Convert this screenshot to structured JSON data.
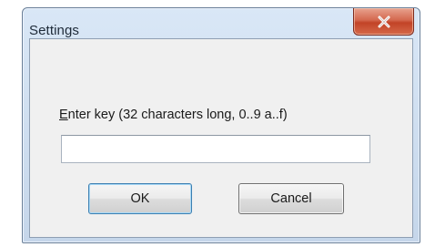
{
  "window": {
    "title": "Settings",
    "close_icon": "close-x-icon"
  },
  "form": {
    "prompt_mnemonic": "E",
    "prompt_rest": "nter key (32 characters long, 0..9 a..f)",
    "key_value": "",
    "key_placeholder": ""
  },
  "buttons": {
    "ok_label": "OK",
    "cancel_label": "Cancel"
  },
  "colors": {
    "title_bar": "#c5d6ea",
    "close_button": "#c24327",
    "dialog_background": "#f0f0f0",
    "default_button_border": "#3c7fb1"
  }
}
